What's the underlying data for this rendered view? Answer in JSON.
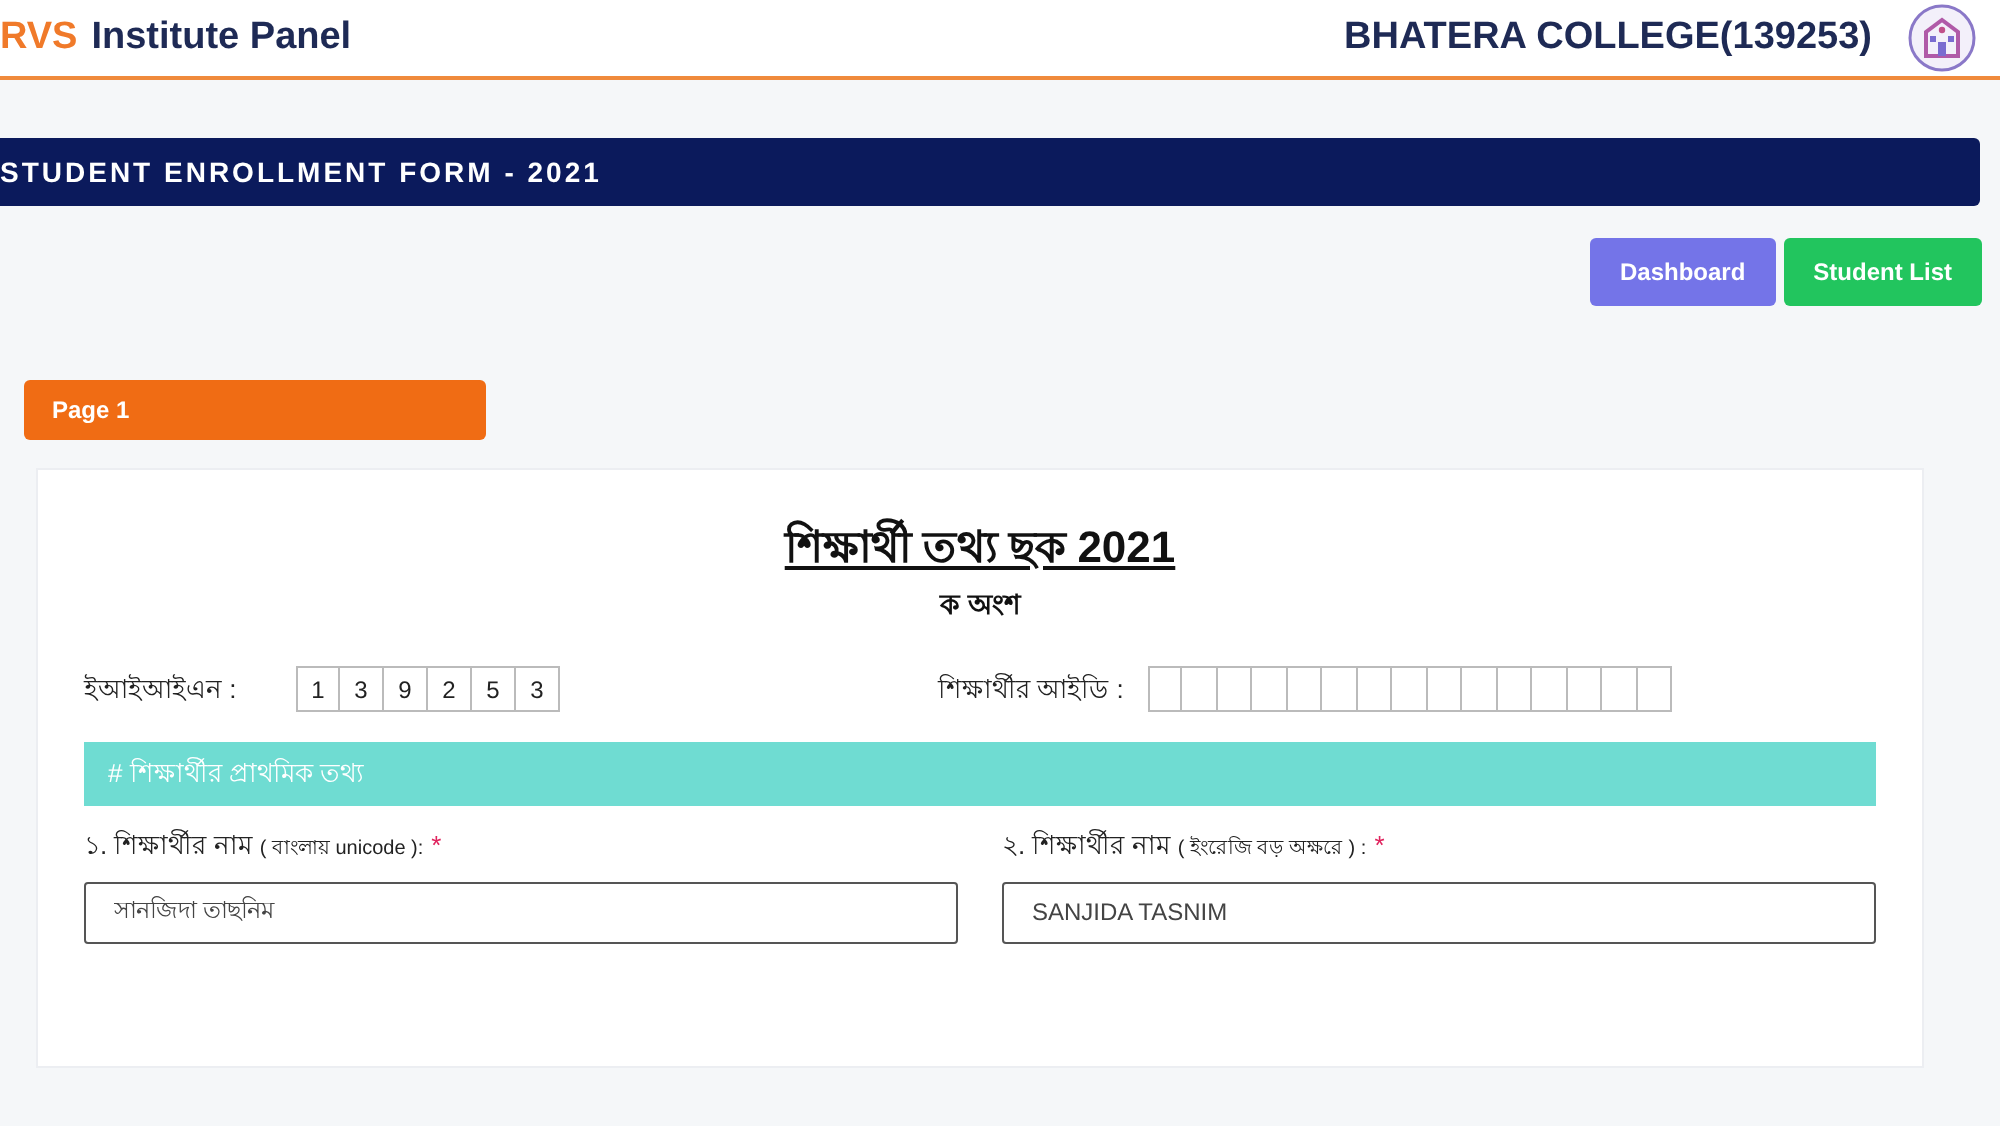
{
  "header": {
    "brand_prefix": "RVS",
    "brand_name": "Institute Panel",
    "college": "BHATERA COLLEGE(139253)"
  },
  "form_banner": "STUDENT ENROLLMENT FORM - 2021",
  "buttons": [
    {
      "label": "Dashboard",
      "kind": "dashboard"
    },
    {
      "label": "Student List",
      "kind": "list"
    }
  ],
  "page_tab": "Page 1",
  "card": {
    "title": "শিক্ষার্থী তথ্য ছক 2021",
    "subtitle": "ক অংশ",
    "eiin": {
      "label": "ইআইআইএন :",
      "digits": [
        "1",
        "3",
        "9",
        "2",
        "5",
        "3"
      ]
    },
    "student_id": {
      "label": "শিক্ষার্থীর আইডি :"
    },
    "section": "# শিক্ষার্থীর প্রাথমিক তথ্য",
    "fields": [
      {
        "label": "১. শিক্ষার্থীর নাম",
        "hint": "( বাংলায় unicode ):",
        "required_mark": "*",
        "value": "সানজিদা তাছনিম"
      },
      {
        "label": "২. শিক্ষার্থীর নাম",
        "hint": "( ইংরেজি বড় অক্ষরে ) :",
        "required_mark": "*",
        "value": "SANJIDA TASNIM"
      }
    ]
  }
}
